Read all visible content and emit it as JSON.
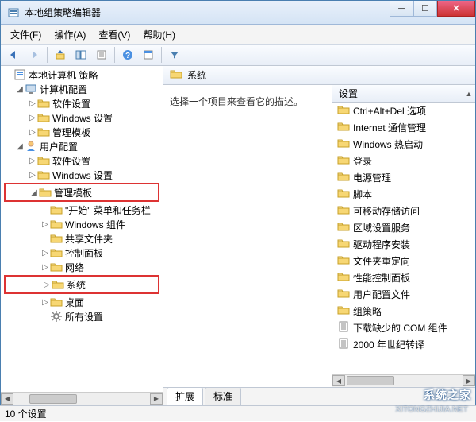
{
  "window": {
    "title": "本地组策略编辑器"
  },
  "menu": {
    "file": "文件(F)",
    "action": "操作(A)",
    "view": "查看(V)",
    "help": "帮助(H)"
  },
  "tree": {
    "root": "本地计算机 策略",
    "computer": "计算机配置",
    "comp_items": [
      "软件设置",
      "Windows 设置",
      "管理模板"
    ],
    "user": "用户配置",
    "user_soft": "软件设置",
    "user_win": "Windows 设置",
    "user_admin": "管理模板",
    "admin_items": [
      "\"开始\" 菜单和任务栏",
      "Windows 组件",
      "共享文件夹",
      "控制面板",
      "网络",
      "系统",
      "桌面",
      "所有设置"
    ]
  },
  "right": {
    "header": "系统",
    "prompt": "选择一个项目来查看它的描述。",
    "col": "设置",
    "items": [
      "Ctrl+Alt+Del 选项",
      "Internet 通信管理",
      "Windows 热启动",
      "登录",
      "电源管理",
      "脚本",
      "可移动存储访问",
      "区域设置服务",
      "驱动程序安装",
      "文件夹重定向",
      "性能控制面板",
      "用户配置文件",
      "组策略",
      "下载缺少的 COM 组件",
      "2000 年世纪转译"
    ]
  },
  "tabs": {
    "extended": "扩展",
    "standard": "标准"
  },
  "status": "10 个设置",
  "watermark": {
    "main": "系统之家",
    "sub": "XITONGZHIJIA.NET"
  }
}
